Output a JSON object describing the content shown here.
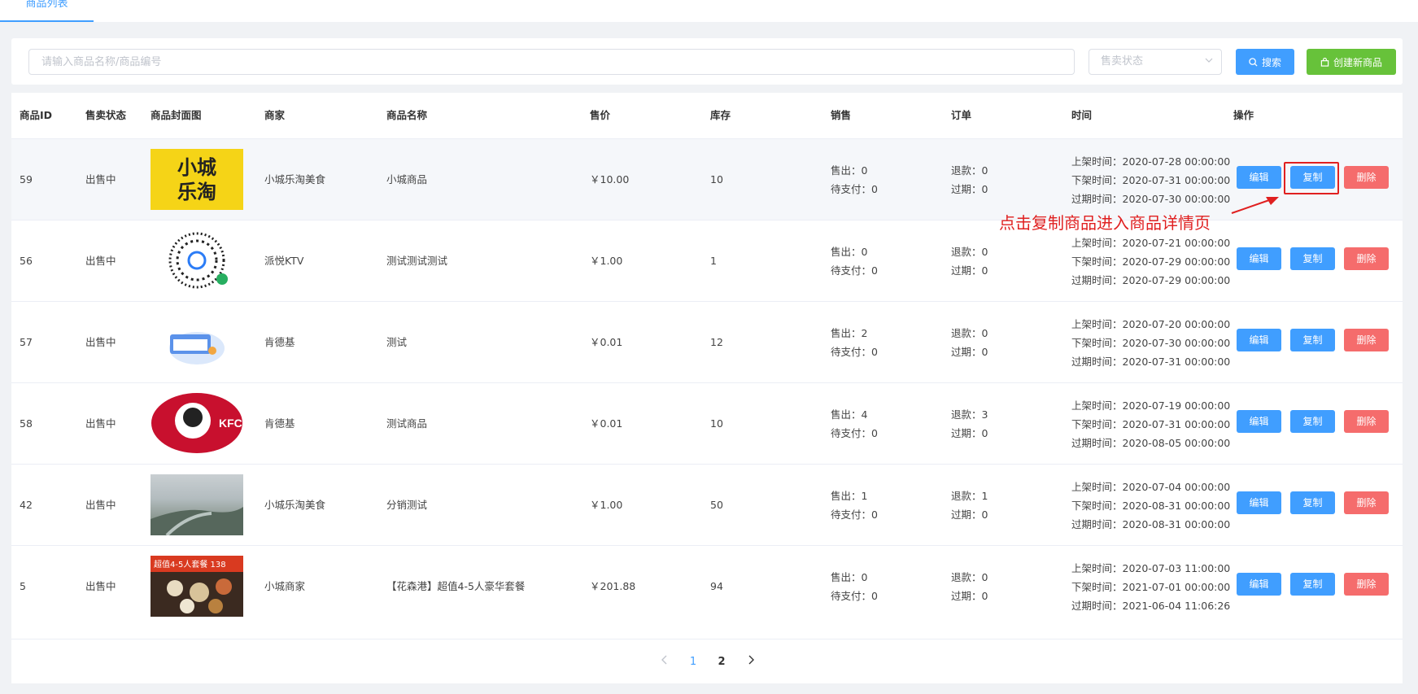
{
  "tab": {
    "label": "商品列表"
  },
  "search": {
    "placeholder": "请输入商品名称/商品编号",
    "status_placeholder": "售卖状态",
    "search_label": "搜索",
    "create_label": "创建新商品"
  },
  "table": {
    "headers": {
      "id": "商品ID",
      "status": "售卖状态",
      "cover": "商品封面图",
      "merchant": "商家",
      "name": "商品名称",
      "price": "售价",
      "stock": "库存",
      "sales": "销售",
      "orders": "订单",
      "time": "时间",
      "ops": "操作"
    },
    "rows": [
      {
        "id": "59",
        "status": "出售中",
        "merchant": "小城乐淘美食",
        "name": "小城商品",
        "price": "￥10.00",
        "stock": "10",
        "sold": "售出：0",
        "pending": "待支付：0",
        "refund": "退款：0",
        "expired": "过期：0",
        "on_time": "上架时间：2020-07-28 00:00:00",
        "off_time": "下架时间：2020-07-31 00:00:00",
        "exp_time": "过期时间：2020-07-30 00:00:00",
        "cover_text": "小城乐淘"
      },
      {
        "id": "56",
        "status": "出售中",
        "merchant": "派悦KTV",
        "name": "测试测试测试",
        "price": "￥1.00",
        "stock": "1",
        "sold": "售出：0",
        "pending": "待支付：0",
        "refund": "退款：0",
        "expired": "过期：0",
        "on_time": "上架时间：2020-07-21 00:00:00",
        "off_time": "下架时间：2020-07-29 00:00:00",
        "exp_time": "过期时间：2020-07-29 00:00:00"
      },
      {
        "id": "57",
        "status": "出售中",
        "merchant": "肯德基",
        "name": "测试",
        "price": "￥0.01",
        "stock": "12",
        "sold": "售出：2",
        "pending": "待支付：0",
        "refund": "退款：0",
        "expired": "过期：0",
        "on_time": "上架时间：2020-07-20 00:00:00",
        "off_time": "下架时间：2020-07-30 00:00:00",
        "exp_time": "过期时间：2020-07-31 00:00:00"
      },
      {
        "id": "58",
        "status": "出售中",
        "merchant": "肯德基",
        "name": "测试商品",
        "price": "￥0.01",
        "stock": "10",
        "sold": "售出：4",
        "pending": "待支付：0",
        "refund": "退款：3",
        "expired": "过期：0",
        "on_time": "上架时间：2020-07-19 00:00:00",
        "off_time": "下架时间：2020-07-31 00:00:00",
        "exp_time": "过期时间：2020-08-05 00:00:00",
        "cover_text": "KFC"
      },
      {
        "id": "42",
        "status": "出售中",
        "merchant": "小城乐淘美食",
        "name": "分销测试",
        "price": "￥1.00",
        "stock": "50",
        "sold": "售出：1",
        "pending": "待支付：0",
        "refund": "退款：1",
        "expired": "过期：0",
        "on_time": "上架时间：2020-07-04 00:00:00",
        "off_time": "下架时间：2020-08-31 00:00:00",
        "exp_time": "过期时间：2020-08-31 00:00:00"
      },
      {
        "id": "5",
        "status": "出售中",
        "merchant": "小城商家",
        "name": "【花森港】超值4-5人豪华套餐",
        "price": "￥201.88",
        "stock": "94",
        "sold": "售出：0",
        "pending": "待支付：0",
        "refund": "退款：0",
        "expired": "过期：0",
        "on_time": "上架时间：2020-07-03 11:00:00",
        "off_time": "下架时间：2021-07-01 00:00:00",
        "exp_time": "过期时间：2021-06-04 11:06:26",
        "cover_text": "超值4-5人套餐 138"
      }
    ],
    "edit_label": "编辑",
    "copy_label": "复制",
    "delete_label": "删除"
  },
  "pagination": {
    "current": "1",
    "next_page": "2"
  },
  "annotation": {
    "text": "点击复制商品进入商品详情页"
  },
  "colors": {
    "primary": "#409eff",
    "success": "#67c23a",
    "danger": "#f56c6c",
    "annotation": "#e02020"
  }
}
